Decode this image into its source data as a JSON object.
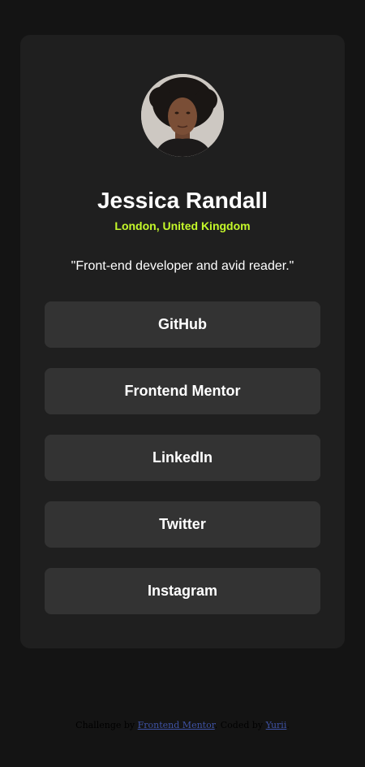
{
  "profile": {
    "name": "Jessica Randall",
    "location": "London, United Kingdom",
    "bio": "\"Front-end developer and avid reader.\"",
    "avatar_icon": "profile-photo"
  },
  "links": [
    {
      "label": "GitHub"
    },
    {
      "label": "Frontend Mentor"
    },
    {
      "label": "LinkedIn"
    },
    {
      "label": "Twitter"
    },
    {
      "label": "Instagram"
    }
  ],
  "attribution": {
    "prefix": "Challenge by",
    "challenge_link": "Frontend Mentor",
    "middle": ". Coded by",
    "author_link": "Yurii",
    "suffix": "."
  },
  "colors": {
    "background": "#141414",
    "card": "#1f1f1f",
    "button": "#333333",
    "accent": "#c4f82a",
    "text": "#ffffff"
  }
}
